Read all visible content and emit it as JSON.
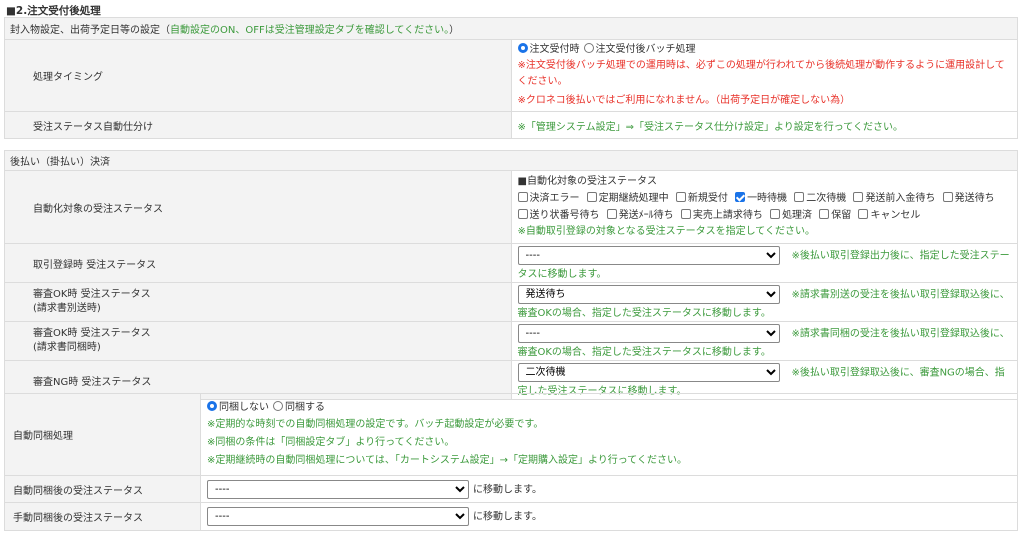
{
  "section_title": "■2.注文受付後処理",
  "t1": {
    "header_prefix": "封入物設定、出荷予定日等の設定（",
    "header_green": "自動設定のON、OFFは受注管理設定タブを確認してください。",
    "header_suffix": "）",
    "timing": {
      "label": "処理タイミング",
      "options": [
        "注文受付時",
        "注文受付後バッチ処理"
      ],
      "selected": 0,
      "note1": "※注文受付後バッチ処理での運用時は、必ずこの処理が行われてから後続処理が動作するように運用設計してください。",
      "note2": "※クロネコ後払いではご利用になれません。（出荷予定日が確定しない為）"
    },
    "auto_sort": {
      "label": "受注ステータス自動仕分け",
      "note": "※「管理システム設定」⇒「受注ステータス仕分け設定」より設定を行ってください。"
    }
  },
  "t2": {
    "header": "後払い（掛払い）決済",
    "auto_target": {
      "label": "自動化対象の受注ステータス",
      "subtitle": "■自動化対象の受注ステータス",
      "checkboxes": [
        {
          "label": "決済エラー",
          "checked": false
        },
        {
          "label": "定期継続処理中",
          "checked": false
        },
        {
          "label": "新規受付",
          "checked": false
        },
        {
          "label": "一時待機",
          "checked": true
        },
        {
          "label": "二次待機",
          "checked": false
        },
        {
          "label": "発送前入金待ち",
          "checked": false
        },
        {
          "label": "発送待ち",
          "checked": false
        },
        {
          "label": "送り状番号待ち",
          "checked": false
        },
        {
          "label": "発送ﾒｰﾙ待ち",
          "checked": false
        },
        {
          "label": "実売上請求待ち",
          "checked": false
        },
        {
          "label": "処理済",
          "checked": false
        },
        {
          "label": "保留",
          "checked": false
        },
        {
          "label": "キャンセル",
          "checked": false
        }
      ],
      "note": "※自動取引登録の対象となる受注ステータスを指定してください。"
    },
    "rows": [
      {
        "label": "取引登録時 受注ステータス",
        "sub": "",
        "value": "----",
        "note": "※後払い取引登録出力後に、指定した受注ステータスに移動します。"
      },
      {
        "label": "審査OK時 受注ステータス",
        "sub": "(請求書別送時)",
        "value": "発送待ち",
        "note": "※請求書別送の受注を後払い取引登録取込後に、審査OKの場合、指定した受注ステータスに移動します。"
      },
      {
        "label": "審査OK時 受注ステータス",
        "sub": "(請求書同梱時)",
        "value": "----",
        "note": "※請求書同梱の受注を後払い取引登録取込後に、審査OKの場合、指定した受注ステータスに移動します。"
      },
      {
        "label": "審査NG時 受注ステータス",
        "sub": "",
        "value": "二次待機",
        "note": "※後払い取引登録取込後に、審査NGの場合、指定した受注ステータスに移動します。"
      }
    ]
  },
  "t3": {
    "auto_bundle": {
      "label": "自動同梱処理",
      "options": [
        "同梱しない",
        "同梱する"
      ],
      "selected": 0,
      "notes": [
        "※定期的な時刻での自動同梱処理の設定です。バッチ起動設定が必要です。",
        "※同梱の条件は「同梱設定タブ」より行ってください。",
        "※定期継続時の自動同梱処理については、「カートシステム設定」→「定期購入設定」より行ってください。"
      ]
    },
    "after_auto": {
      "label": "自動同梱後の受注ステータス",
      "value": "----",
      "suffix": "に移動します。"
    },
    "after_manual": {
      "label": "手動同梱後の受注ステータス",
      "value": "----",
      "suffix": "に移動します。"
    }
  }
}
